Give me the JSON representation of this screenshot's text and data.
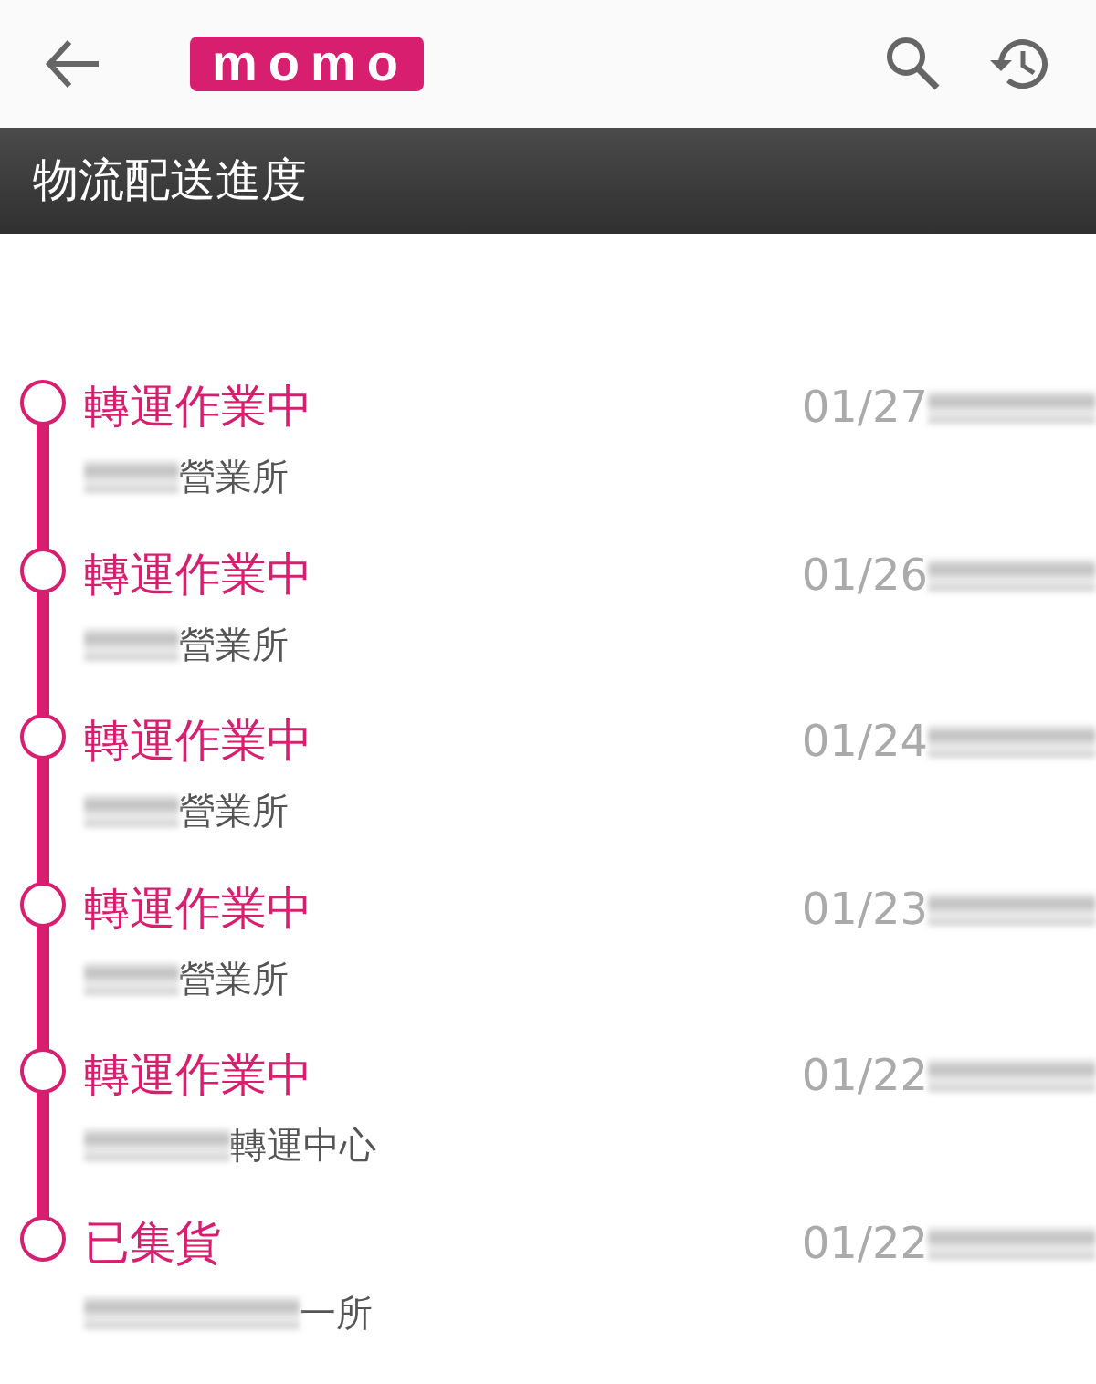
{
  "app_bar": {
    "logo": "momo"
  },
  "section_title": "物流配送進度",
  "events": [
    {
      "status": "轉運作業中",
      "date": "01/27",
      "location": "營業所"
    },
    {
      "status": "轉運作業中",
      "date": "01/26",
      "location": "營業所"
    },
    {
      "status": "轉運作業中",
      "date": "01/24",
      "location": "營業所"
    },
    {
      "status": "轉運作業中",
      "date": "01/23",
      "location": "營業所"
    },
    {
      "status": "轉運作業中",
      "date": "01/22",
      "location": "轉運中心"
    },
    {
      "status": "已集貨",
      "date": "01/22",
      "location": "一所"
    }
  ]
}
